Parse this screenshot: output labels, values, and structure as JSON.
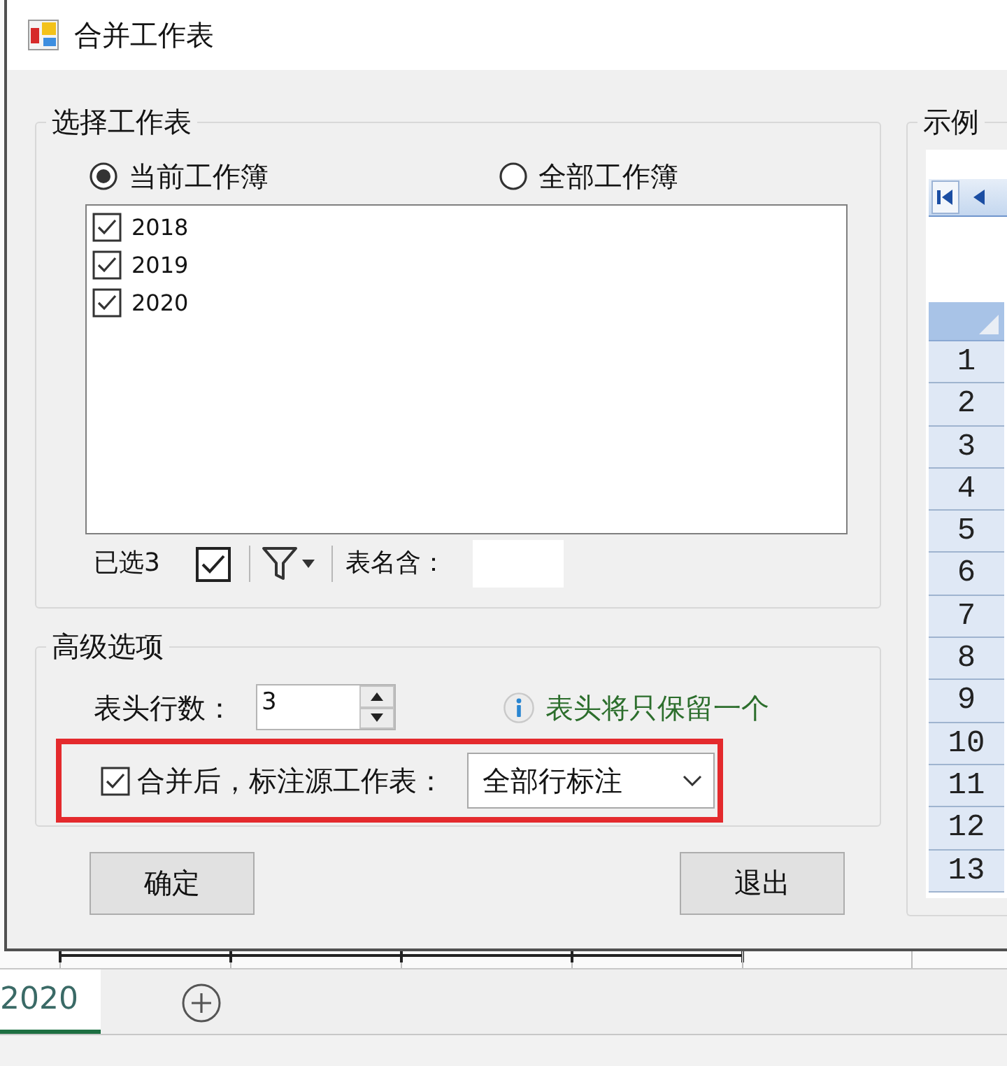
{
  "window": {
    "title": "合并工作表"
  },
  "sheet_selection": {
    "title": "选择工作表",
    "scope_options": [
      {
        "label": "当前工作簿",
        "selected": true
      },
      {
        "label": "全部工作簿",
        "selected": false
      }
    ],
    "sheets": [
      {
        "name": "2018",
        "checked": true
      },
      {
        "name": "2019",
        "checked": true
      },
      {
        "name": "2020",
        "checked": true
      }
    ],
    "selected_count": "已选3",
    "filter_label": "表名含："
  },
  "advanced_options": {
    "title": "高级选项",
    "header_rows_label": "表头行数：",
    "header_rows_value": "3",
    "hint": "表头将只保留一个",
    "mark_source": {
      "label": "合并后，标注源工作表：",
      "checked": true,
      "highlighted": true,
      "mode": "全部行标注"
    }
  },
  "buttons": [
    {
      "label": "确定"
    },
    {
      "label": "退出"
    }
  ],
  "example": {
    "title": "示例",
    "row_numbers": [
      "1",
      "2",
      "3",
      "4",
      "5",
      "6",
      "7",
      "8",
      "9",
      "10",
      "11",
      "12",
      "13"
    ]
  },
  "sheet_tabs": [
    {
      "label": "2020",
      "selected": true
    }
  ]
}
